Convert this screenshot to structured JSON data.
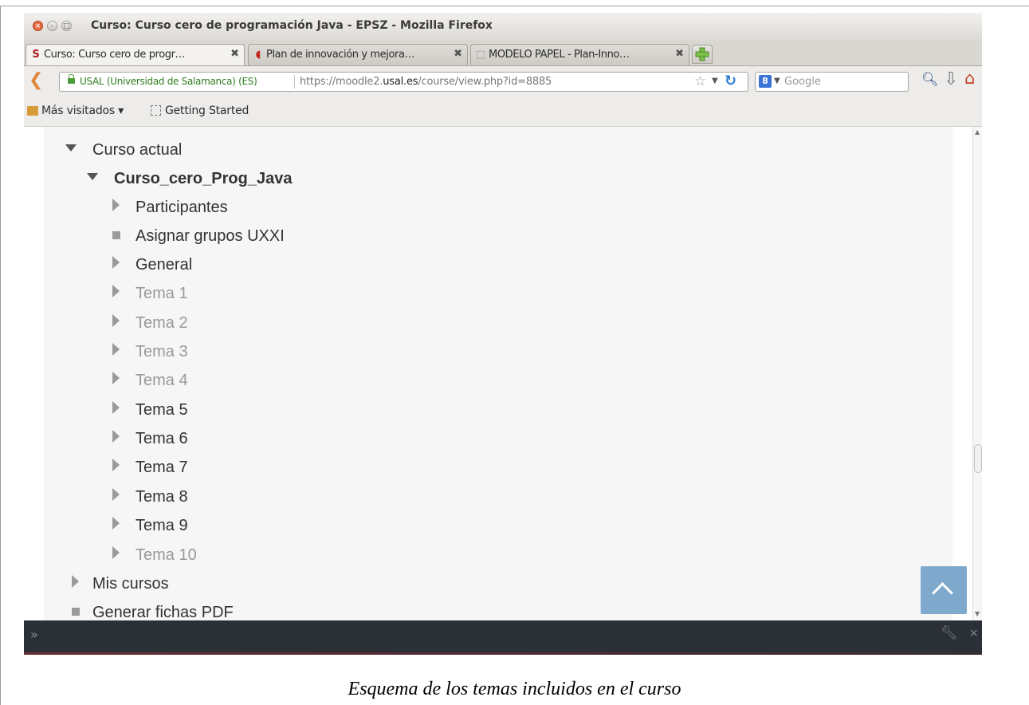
{
  "window": {
    "title": "Curso: Curso cero de programación Java - EPSZ - Mozilla Firefox"
  },
  "tabs": [
    {
      "label": "Curso: Curso cero de progr…",
      "favicon": "usal-logo-icon",
      "close": "✖"
    },
    {
      "label": "Plan de innovación y mejora…",
      "favicon": "red-doc-icon",
      "close": "✖"
    },
    {
      "label": "MODELO PAPEL - Plan-Inno…",
      "favicon": "blank-page-icon",
      "close": "✖"
    }
  ],
  "navbar": {
    "identity": "USAL (Universidad de Salamanca) (ES)",
    "url_prefix": "https://moodle2.",
    "url_domain": "usal.es",
    "url_suffix": "/course/view.php?id=8885",
    "search_placeholder": "Google"
  },
  "bookmarks": [
    {
      "label": "Más visitados ▾"
    },
    {
      "label": "Getting Started"
    }
  ],
  "tree": [
    {
      "label": "Curso actual",
      "icon": "triangle-down",
      "state": "normal"
    },
    {
      "label": "Curso_cero_Prog_Java",
      "icon": "triangle-down",
      "state": "bold"
    },
    {
      "label": "Participantes",
      "icon": "triangle-right",
      "state": "normal"
    },
    {
      "label": "Asignar grupos UXXI",
      "icon": "square",
      "state": "normal"
    },
    {
      "label": "General",
      "icon": "triangle-right",
      "state": "normal"
    },
    {
      "label": "Tema 1",
      "icon": "triangle-right",
      "state": "dim"
    },
    {
      "label": "Tema 2",
      "icon": "triangle-right",
      "state": "dim"
    },
    {
      "label": "Tema 3",
      "icon": "triangle-right",
      "state": "dim"
    },
    {
      "label": "Tema 4",
      "icon": "triangle-right",
      "state": "dim"
    },
    {
      "label": "Tema 5",
      "icon": "triangle-right",
      "state": "normal"
    },
    {
      "label": "Tema 6",
      "icon": "triangle-right",
      "state": "normal"
    },
    {
      "label": "Tema 7",
      "icon": "triangle-right",
      "state": "normal"
    },
    {
      "label": "Tema 8",
      "icon": "triangle-right",
      "state": "normal"
    },
    {
      "label": "Tema 9",
      "icon": "triangle-right",
      "state": "normal"
    },
    {
      "label": "Tema 10",
      "icon": "triangle-right",
      "state": "dim"
    },
    {
      "label": "Mis cursos",
      "icon": "triangle-right",
      "state": "normal"
    },
    {
      "label": "Generar fichas PDF",
      "icon": "square",
      "state": "normal"
    }
  ],
  "caption": "Esquema de los temas incluidos en el curso",
  "colors": {
    "text": "#333333",
    "text_dim": "#999999",
    "back_to_top": "#7fa9cc",
    "devtools": "#2b2f36"
  }
}
